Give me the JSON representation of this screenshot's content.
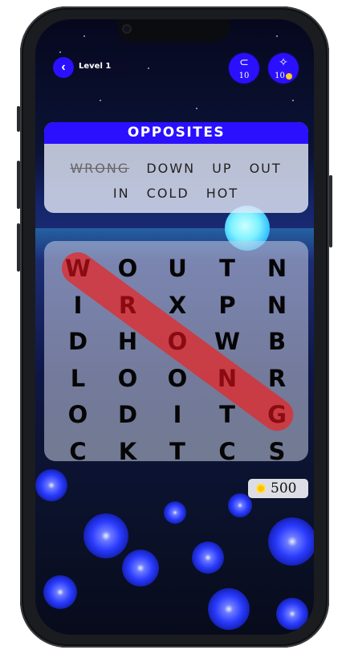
{
  "header": {
    "back_icon": "chevron-left-icon",
    "level_label": "Level 1",
    "powerups": [
      {
        "icon": "magnet-icon",
        "count": "10"
      },
      {
        "icon": "magic-wand-icon",
        "count": "10"
      }
    ]
  },
  "category": {
    "title": "OPPOSITES",
    "words": [
      {
        "text": "WRONG",
        "found": true
      },
      {
        "text": "DOWN",
        "found": false
      },
      {
        "text": "UP",
        "found": false
      },
      {
        "text": "OUT",
        "found": false
      },
      {
        "text": "IN",
        "found": false
      },
      {
        "text": "COLD",
        "found": false
      },
      {
        "text": "HOT",
        "found": false
      }
    ]
  },
  "grid": {
    "rows": [
      [
        "W",
        "O",
        "U",
        "T",
        "N"
      ],
      [
        "I",
        "R",
        "X",
        "P",
        "N"
      ],
      [
        "D",
        "H",
        "O",
        "W",
        "B"
      ],
      [
        "L",
        "O",
        "O",
        "N",
        "R"
      ],
      [
        "O",
        "D",
        "I",
        "T",
        "G"
      ],
      [
        "C",
        "K",
        "T",
        "C",
        "S"
      ]
    ],
    "selected_word": "WRONG",
    "selected_cells": [
      [
        0,
        0
      ],
      [
        1,
        1
      ],
      [
        2,
        2
      ],
      [
        3,
        3
      ],
      [
        4,
        4
      ]
    ],
    "highlight_color": "#e62828"
  },
  "wallet": {
    "coin_icon": "coin-icon",
    "amount": "500"
  },
  "colors": {
    "accent": "#2a10ff",
    "found_letter": "#8b0b12"
  }
}
